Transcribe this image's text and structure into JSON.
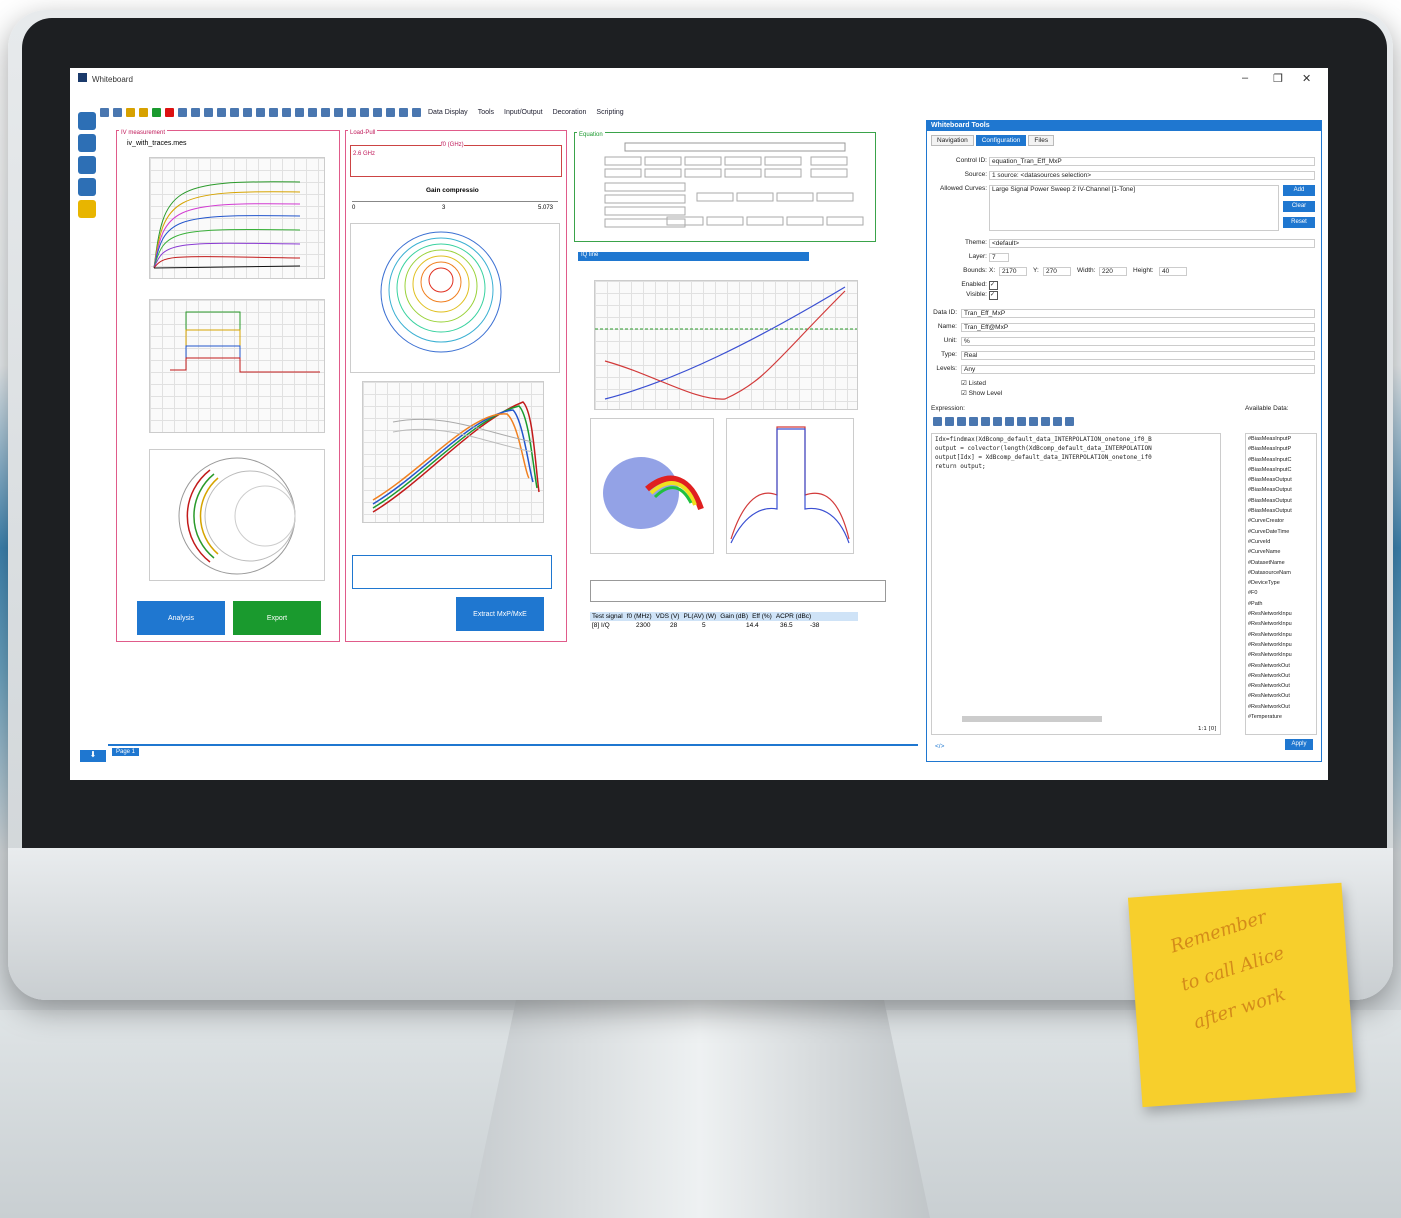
{
  "window": {
    "title": "Whiteboard"
  },
  "toolbar": {
    "menus": [
      "Data Display",
      "Tools",
      "Input/Output",
      "Decoration",
      "Scripting"
    ]
  },
  "panels": {
    "iv": {
      "title": "IV measurement",
      "file": "iv_with_traces.mes",
      "buttons": {
        "analysis": "Analysis",
        "export": "Export"
      }
    },
    "loadpull": {
      "title": "Load-Pull",
      "freq_label": "f0 (GHz)",
      "freq_value": "2.6 GHz",
      "gain_label": "Gain compressio",
      "slider_min": "0",
      "slider_mid": "3",
      "slider_max": "5.073",
      "extract_button": "Extract MxP/MxE"
    },
    "equation": {
      "title": "Equation"
    },
    "iq": {
      "title": "IQ line"
    }
  },
  "datatable": {
    "headers": [
      "Test signal",
      "f0 (MHz)",
      "VDS (V)",
      "PL(AV) (W)",
      "Gain (dB)",
      "Eff (%)",
      "ACPR (dBc)"
    ],
    "row": [
      "[8] I/Q",
      "2300",
      "28",
      "5",
      "14.4",
      "36.5",
      "-38"
    ]
  },
  "wbtools": {
    "title": "Whiteboard Tools",
    "tabs": [
      "Navigation",
      "Configuration",
      "Files"
    ],
    "control_id_label": "Control ID:",
    "control_id": "equation_Tran_Eff_MxP",
    "source_label": "Source:",
    "source": "1 source: <datasources selection>",
    "allowed_label": "Allowed Curves:",
    "allowed": "Large Signal Power Sweep 2 IV-Channel [1-Tone]",
    "add": "Add",
    "clear": "Clear",
    "reset": "Reset",
    "theme_label": "Theme:",
    "theme": "<default>",
    "layer_label": "Layer:",
    "layer": "7",
    "bounds_label": "Bounds:",
    "x_label": "X:",
    "x": "2170",
    "y_label": "Y:",
    "y": "270",
    "width_label": "Width:",
    "width": "220",
    "height_label": "Height:",
    "height": "40",
    "enabled_label": "Enabled:",
    "visible_label": "Visible:",
    "dataid_label": "Data ID:",
    "dataid": "Tran_Eff_MxP",
    "name_label": "Name:",
    "name": "Tran_Eff@MxP",
    "unit_label": "Unit:",
    "unit": "%",
    "type_label": "Type:",
    "type": "Real",
    "levels_label": "Levels:",
    "levels": "Any",
    "listed": "Listed",
    "show_level": "Show Level",
    "expression_label": "Expression:",
    "available_label": "Available Data:",
    "code": [
      "Idx=findmax(XdBcomp_default_data_INTERPOLATION_onetone_if0_B",
      "output = colvector(length(XdBcomp_default_data_INTERPOLATION",
      "output[Idx] = XdBcomp_default_data_INTERPOLATION_onetone_if0",
      "return output;"
    ],
    "cursor_pos": "1:1 [0]",
    "available": [
      "#BiasMeasInputP",
      "#BiasMeasInputP",
      "#BiasMeasInputC",
      "#BiasMeasInputC",
      "#BiasMeasOutput",
      "#BiasMeasOutput",
      "#BiasMeasOutput",
      "#BiasMeasOutput",
      "#CurveCreator",
      "#CurveDateTime",
      "#CurveId",
      "#CurveName",
      "#DatasetName",
      "#DatasourceNam",
      "#DeviceType",
      "#F0",
      "#Path",
      "#ResNetworkInpu",
      "#ResNetworkInpu",
      "#ResNetworkInpu",
      "#ResNetworkInpu",
      "#ResNetworkInpu",
      "#ResNetworkOut",
      "#ResNetworkOut",
      "#ResNetworkOut",
      "#ResNetworkOut",
      "#ResNetworkOut",
      "#Temperature"
    ],
    "apply": "Apply"
  },
  "pagebar": {
    "page": "Page 1"
  },
  "sticky_note": [
    "Remember",
    "to call Alice",
    "after work"
  ],
  "colors": {
    "accent": "#1f77d0",
    "analysis": "#1f77d0",
    "export": "#1a9a2e",
    "panel_border": "#e05b8a"
  }
}
